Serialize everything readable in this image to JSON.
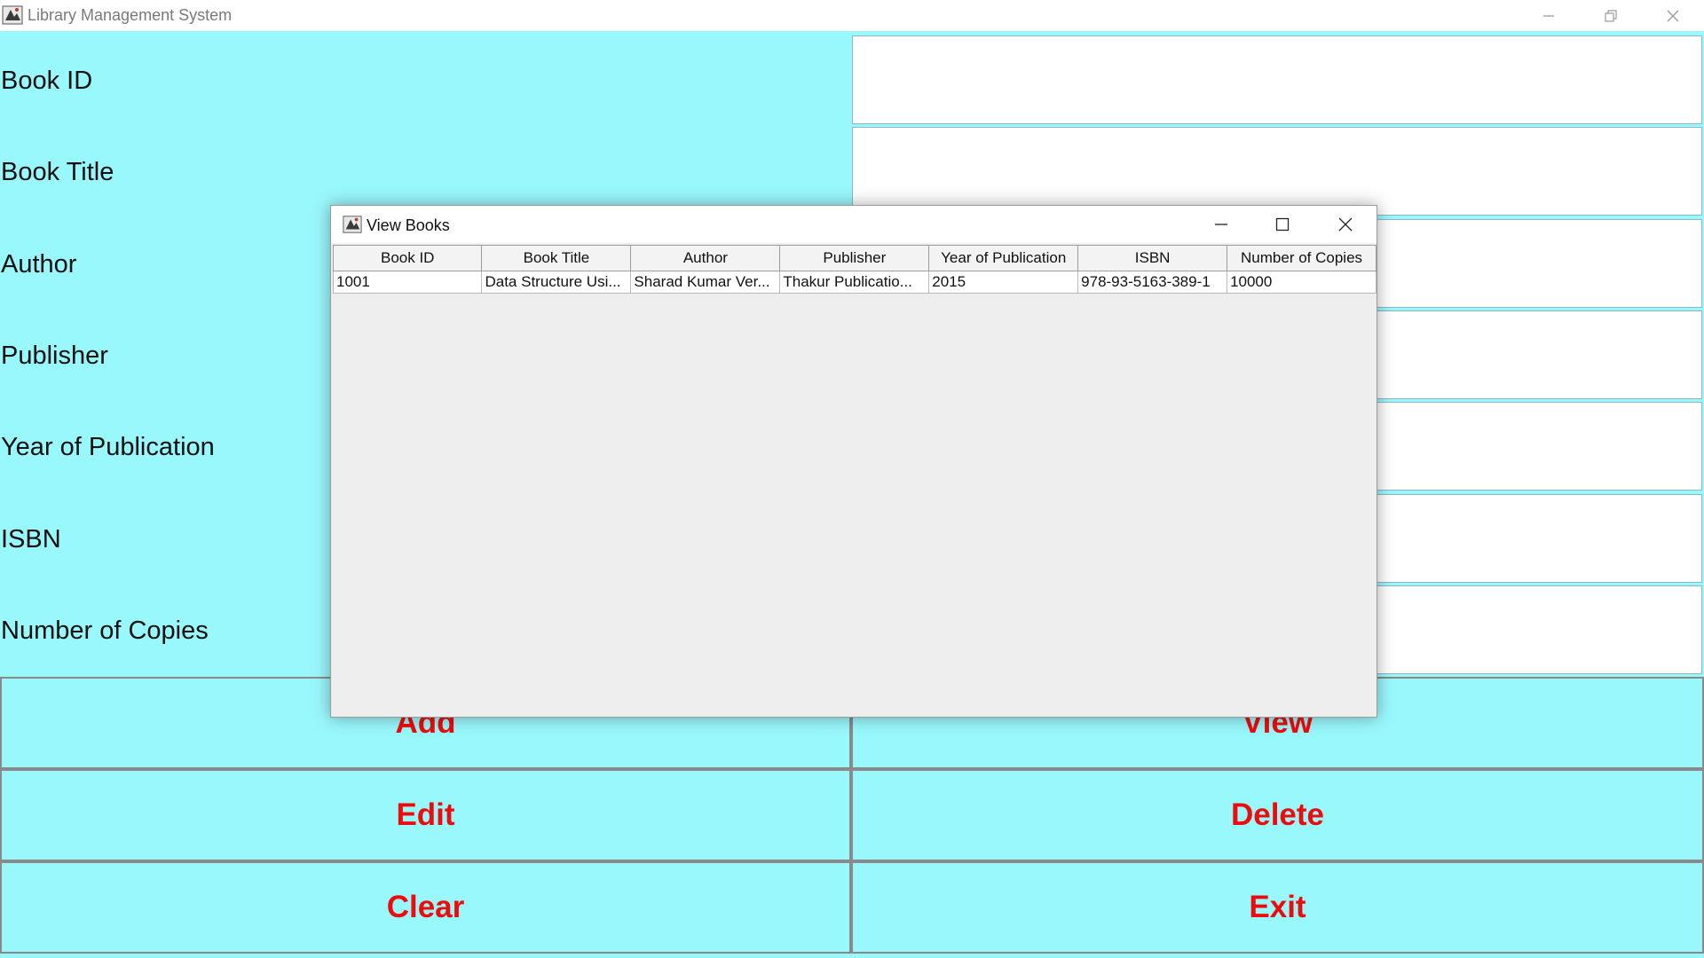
{
  "window": {
    "title": "Library Management System",
    "controls": {
      "minimize": "—",
      "restore": "❐",
      "close": "✕"
    }
  },
  "form": {
    "fields": [
      {
        "label": "Book ID",
        "value": ""
      },
      {
        "label": "Book Title",
        "value": ""
      },
      {
        "label": "Author",
        "value": ""
      },
      {
        "label": "Publisher",
        "value": ""
      },
      {
        "label": "Year of Publication",
        "value": ""
      },
      {
        "label": "ISBN",
        "value": ""
      },
      {
        "label": "Number of Copies",
        "value": ""
      }
    ]
  },
  "buttons": {
    "add": "Add",
    "view": "View",
    "edit": "Edit",
    "delete": "Delete",
    "clear": "Clear",
    "exit": "Exit"
  },
  "dialog": {
    "title": "View Books",
    "controls": {
      "minimize": "—",
      "maximize": "☐",
      "close": "✕"
    },
    "table": {
      "columns": [
        "Book ID",
        "Book Title",
        "Author",
        "Publisher",
        "Year of Publication",
        "ISBN",
        "Number of Copies"
      ],
      "rows": [
        [
          "1001",
          "Data Structure Usi...",
          "Sharad Kumar Ver...",
          "Thakur Publicatio...",
          "2015",
          "978-93-5163-389-1",
          "10000"
        ]
      ]
    }
  },
  "colors": {
    "background": "#99f8fc",
    "button_text": "#ee0b0b",
    "input_background": "#ffffff",
    "dialog_background": "#eeeeee"
  }
}
